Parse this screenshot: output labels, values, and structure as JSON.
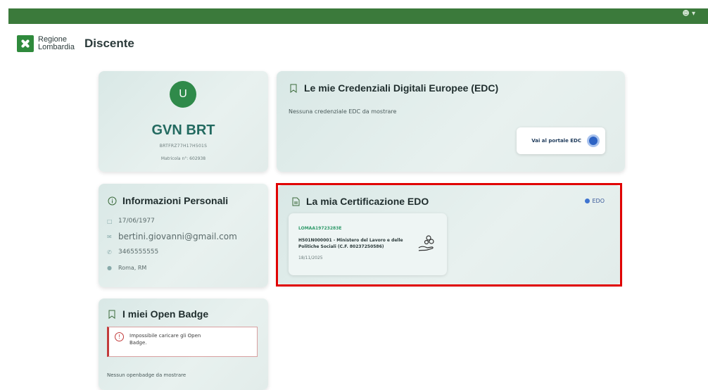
{
  "topbar": {
    "user_icon": "user-icon"
  },
  "header": {
    "logo_line1": "Regione",
    "logo_line2": "Lombardia",
    "title": "Discente"
  },
  "profile": {
    "initial": "U",
    "name": "GVN BRT",
    "codice_fiscale": "BRTFRZ77H17H501S",
    "matricola": "Matricola n°: 602938"
  },
  "edc": {
    "title": "Le mie Credenziali Digitali Europee (EDC)",
    "empty_text": "Nessuna credenziale EDC da mostrare",
    "portal_button": "Vai al portale EDC"
  },
  "info": {
    "title": "Informazioni Personali",
    "birth_date": "17/06/1977",
    "email": "bertini.giovanni@gmail.com",
    "phone": "3465555555",
    "location": "Roma, RM"
  },
  "edo": {
    "title": "La mia Certificazione EDO",
    "logo_text": "EDO",
    "code": "LOMAA19723283E",
    "description": "H501N000001 - Ministero del Lavoro e delle Politiche Sociali (C.F. 80237250586)",
    "date": "18/11/2025"
  },
  "badge": {
    "title": "I miei Open Badge",
    "alert": "Impossibile caricare gli Open Badge.",
    "empty_text": "Nessun openbadge da mostrare"
  },
  "colors": {
    "topbar": "#3b7a3b",
    "accent": "#236a60",
    "highlight": "#e00000"
  }
}
